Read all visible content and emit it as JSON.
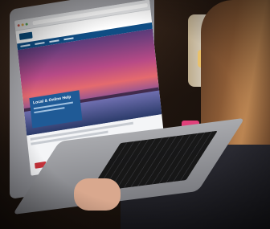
{
  "photo": {
    "subject": "Person using a laptop showing a website with a sunset hero image",
    "website": {
      "hero_title": "Local & Online Help"
    },
    "colors": {
      "site_blue": "#0f4d84",
      "hero_pink": "#b84a86",
      "button_red": "#c8323a"
    }
  }
}
